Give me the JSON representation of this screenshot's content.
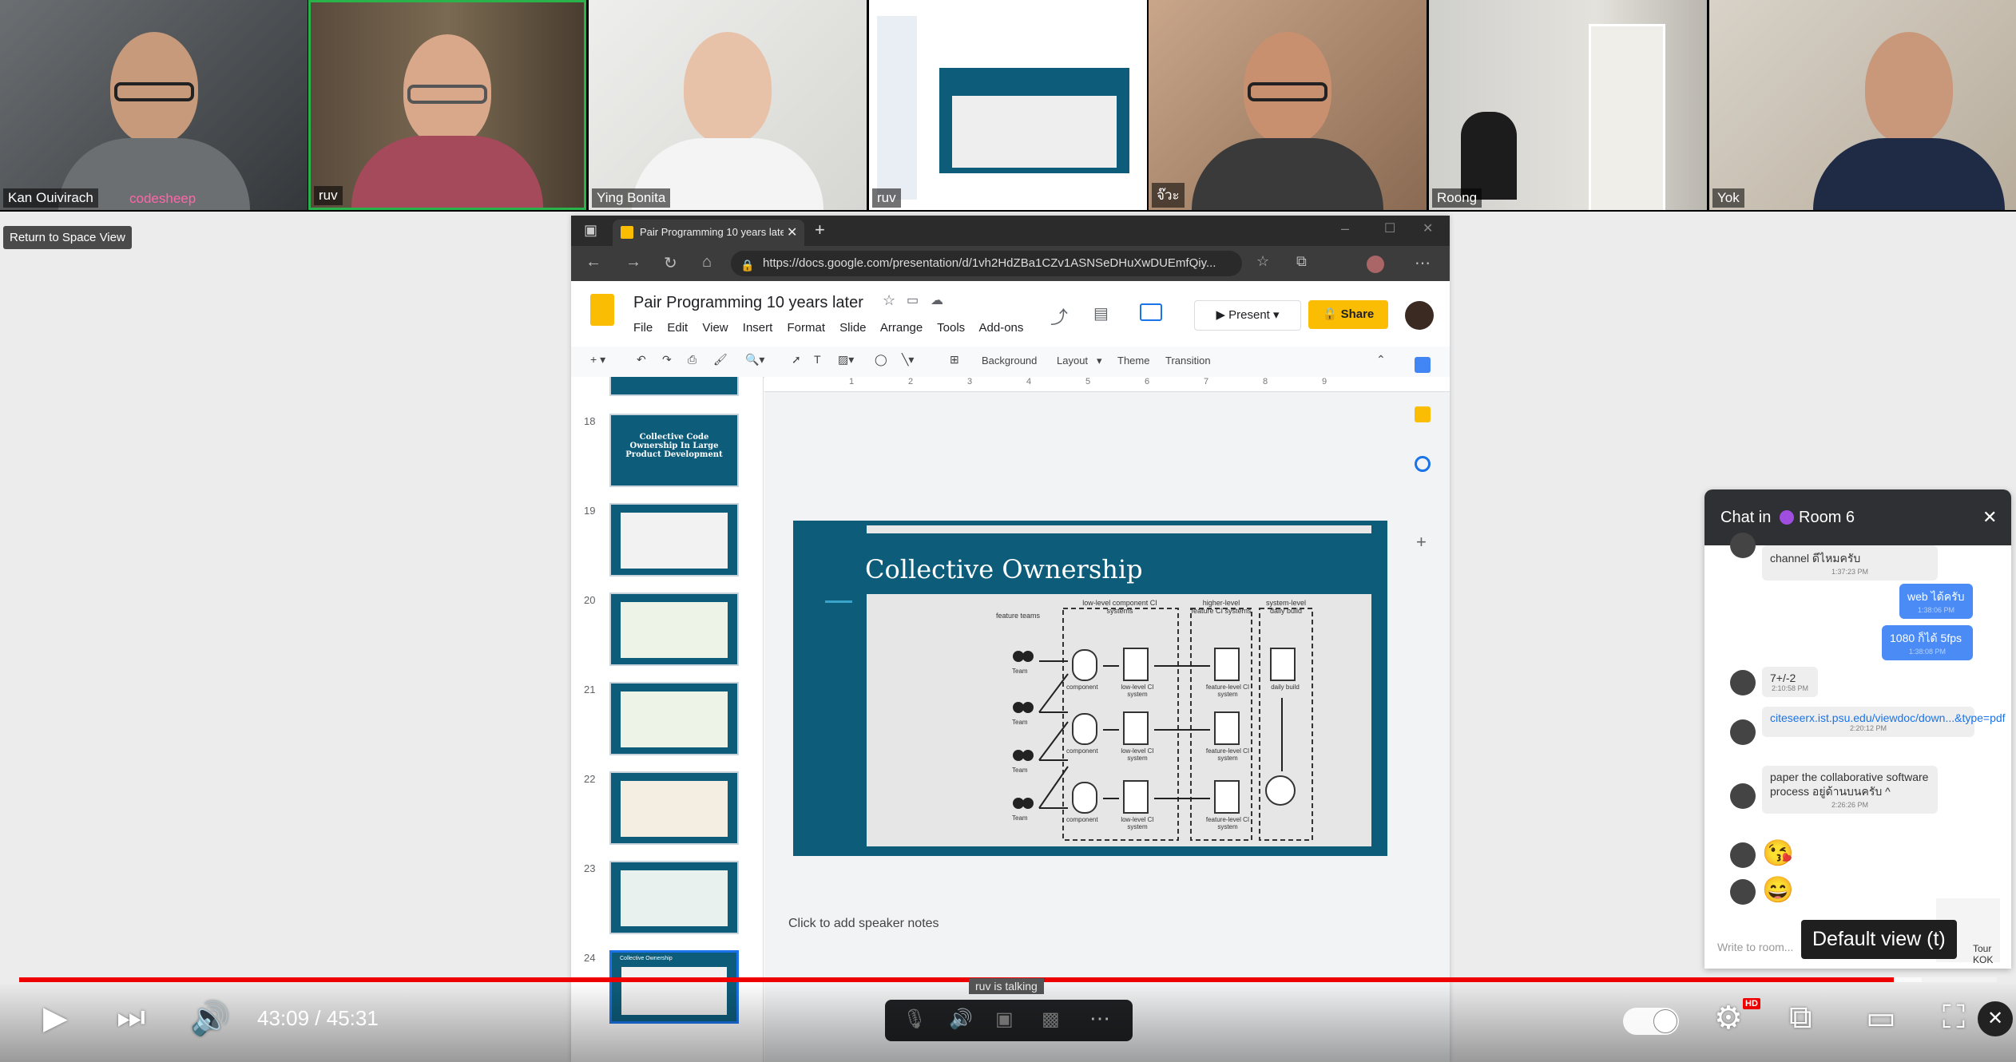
{
  "participants": [
    {
      "name": "Kan Ouivirach",
      "extra": "codesheep"
    },
    {
      "name": "ruv"
    },
    {
      "name": "Ying Bonita"
    },
    {
      "name": "ruv"
    },
    {
      "name": "จ๊วะ"
    },
    {
      "name": "Roong"
    },
    {
      "name": "Yok"
    }
  ],
  "return_button": "Return to Space View",
  "browser": {
    "tab_title": "Pair Programming 10 years later",
    "url": "https://docs.google.com/presentation/d/1vh2HdZBa1CZv1ASNSeDHuXwDUEmfQiy..."
  },
  "docs": {
    "title": "Pair Programming  10 years later",
    "menu": [
      "File",
      "Edit",
      "View",
      "Insert",
      "Format",
      "Slide",
      "Arrange",
      "Tools",
      "Add-ons"
    ],
    "present_label": "Present",
    "share_label": "Share",
    "toolbar": {
      "background": "Background",
      "layout": "Layout",
      "theme": "Theme",
      "transition": "Transition"
    },
    "ruler_ticks": [
      "1",
      "2",
      "3",
      "4",
      "5",
      "6",
      "7",
      "8",
      "9"
    ],
    "speaker_notes": "Click to add speaker notes"
  },
  "filmstrip": {
    "numbers": [
      "18",
      "19",
      "20",
      "21",
      "22",
      "23",
      "24"
    ],
    "slide18_title": "Collective Code Ownership In Large Product Development",
    "slide24_title": "Collective Ownership"
  },
  "slide": {
    "title": "Collective Ownership",
    "labels": {
      "feature_teams": "feature teams",
      "low_level": "low-level component CI systems",
      "higher_level": "higher-level feature CI systems",
      "system_level": "system-level daily build",
      "team": "Team",
      "component": "component",
      "low_ci": "low-level CI system",
      "feature_ci": "feature-level CI system",
      "daily_build": "daily build"
    }
  },
  "chat": {
    "header_prefix": "Chat in",
    "room": "Room 6",
    "messages": [
      {
        "text": "channel ดีไหมครับ",
        "time": "1:37:23 PM",
        "mine": false
      },
      {
        "text": "web ได้ครับ",
        "time": "1:38:06 PM",
        "mine": true
      },
      {
        "text": "1080 ก็ได้ 5fps",
        "time": "1:38:08 PM",
        "mine": true
      },
      {
        "text": "7+/-2",
        "time": "2:10:58 PM",
        "mine": false
      },
      {
        "text": "citeseerx.ist.psu.edu/viewdoc/down...&type=pdf",
        "time": "2:20:12 PM",
        "mine": false
      },
      {
        "text": "paper the collaborative software process อยู่ด้านบนครับ ^",
        "time": "2:26:26 PM",
        "mine": false
      }
    ],
    "emojis": [
      "😘",
      "😄"
    ],
    "input_placeholder": "Write to room...",
    "sticker_text": "Tour KOK"
  },
  "tooltip": "Default view (t)",
  "talking": "ruv is talking",
  "player": {
    "time": "43:09 / 45:31",
    "progress": 0.948,
    "buffered": 0.962,
    "hd_badge": "HD"
  },
  "colors": {
    "accent_red": "#ee0000",
    "share_yellow": "#fbbc04",
    "slide_blue": "#0d5c7a"
  }
}
